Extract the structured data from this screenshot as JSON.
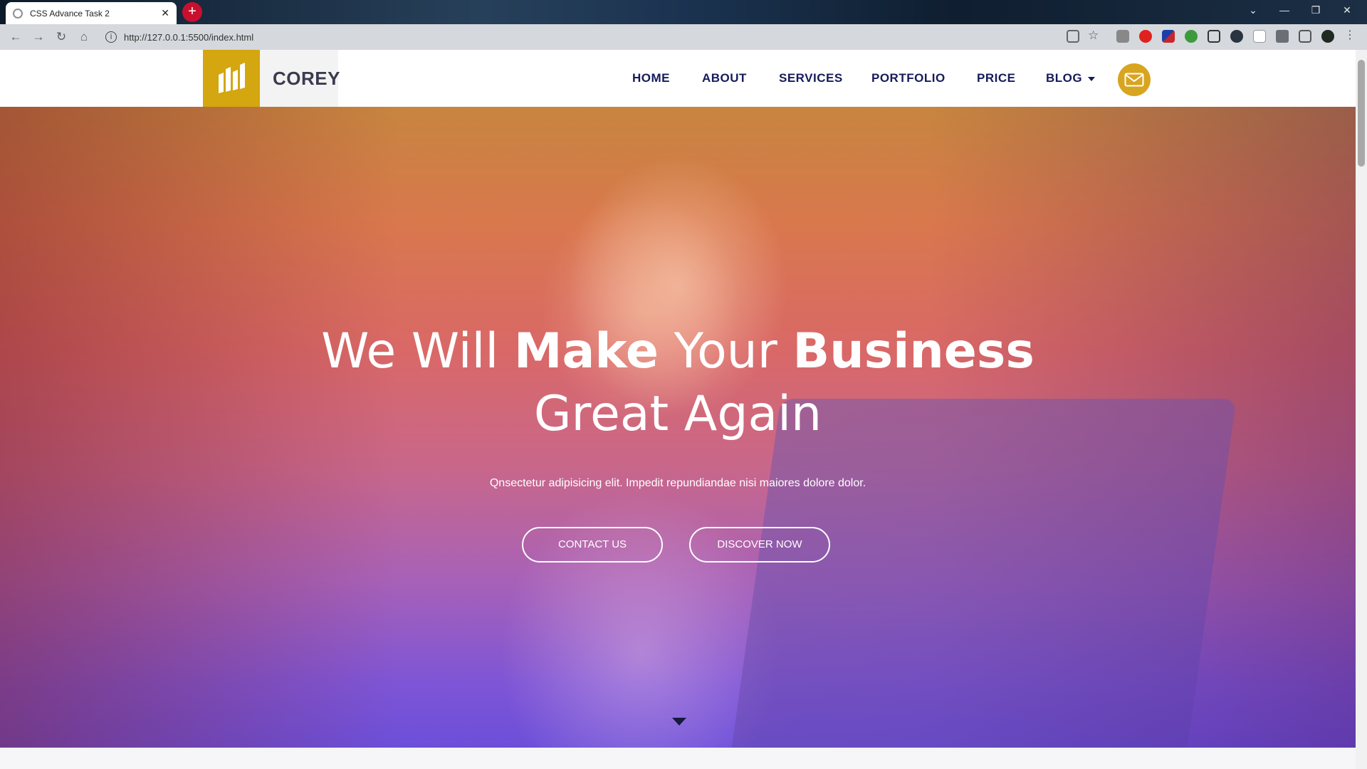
{
  "browser": {
    "tab_title": "CSS Advance Task 2",
    "tab_close": "✕",
    "new_tab": "+",
    "url": "http://127.0.0.1:5500/index.html",
    "window_controls": [
      "⌄",
      "—",
      "❐",
      "✕"
    ]
  },
  "site": {
    "brand_name": "COREY",
    "nav": [
      "HOME",
      "ABOUT",
      "SERVICES",
      "PORTFOLIO",
      "PRICE",
      "BLOG"
    ],
    "accent_color": "#d4a60f",
    "nav_color": "#151b5a"
  },
  "hero": {
    "title_parts": [
      {
        "text": "We Will ",
        "weight": "light"
      },
      {
        "text": "Make",
        "weight": "bold"
      },
      {
        "text": " Your ",
        "weight": "light"
      },
      {
        "text": "Business",
        "weight": "bold"
      }
    ],
    "title_line2": "Great Again",
    "subtitle": "Qnsectetur adipisicing elit. Impedit repundiandae nisi maiores dolore dolor.",
    "buttons": [
      "CONTACT US",
      "DISCOVER NOW"
    ]
  }
}
